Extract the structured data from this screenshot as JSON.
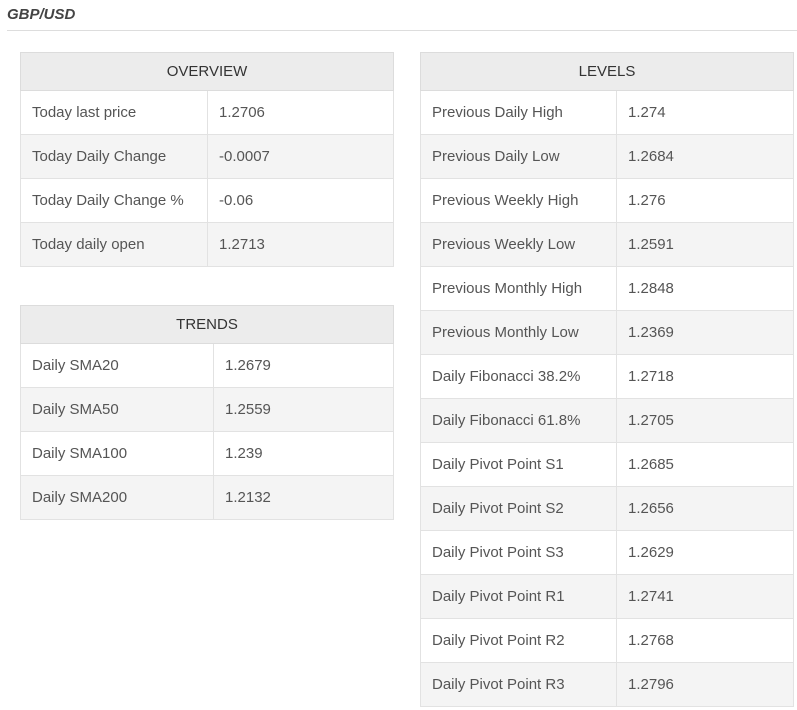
{
  "page": {
    "title": "GBP/USD"
  },
  "overview": {
    "header": "OVERVIEW",
    "rows": [
      {
        "label": "Today last price",
        "value": "1.2706"
      },
      {
        "label": "Today Daily Change",
        "value": "-0.0007"
      },
      {
        "label": "Today Daily Change %",
        "value": "-0.06"
      },
      {
        "label": "Today daily open",
        "value": "1.2713"
      }
    ]
  },
  "trends": {
    "header": "TRENDS",
    "rows": [
      {
        "label": "Daily SMA20",
        "value": "1.2679"
      },
      {
        "label": "Daily SMA50",
        "value": "1.2559"
      },
      {
        "label": "Daily SMA100",
        "value": "1.239"
      },
      {
        "label": "Daily SMA200",
        "value": "1.2132"
      }
    ]
  },
  "levels": {
    "header": "LEVELS",
    "rows": [
      {
        "label": "Previous Daily High",
        "value": "1.274"
      },
      {
        "label": "Previous Daily Low",
        "value": "1.2684"
      },
      {
        "label": "Previous Weekly High",
        "value": "1.276"
      },
      {
        "label": "Previous Weekly Low",
        "value": "1.2591"
      },
      {
        "label": "Previous Monthly High",
        "value": "1.2848"
      },
      {
        "label": "Previous Monthly Low",
        "value": "1.2369"
      },
      {
        "label": "Daily Fibonacci 38.2%",
        "value": "1.2718"
      },
      {
        "label": "Daily Fibonacci 61.8%",
        "value": "1.2705"
      },
      {
        "label": "Daily Pivot Point S1",
        "value": "1.2685"
      },
      {
        "label": "Daily Pivot Point S2",
        "value": "1.2656"
      },
      {
        "label": "Daily Pivot Point S3",
        "value": "1.2629"
      },
      {
        "label": "Daily Pivot Point R1",
        "value": "1.2741"
      },
      {
        "label": "Daily Pivot Point R2",
        "value": "1.2768"
      },
      {
        "label": "Daily Pivot Point R3",
        "value": "1.2796"
      }
    ]
  }
}
